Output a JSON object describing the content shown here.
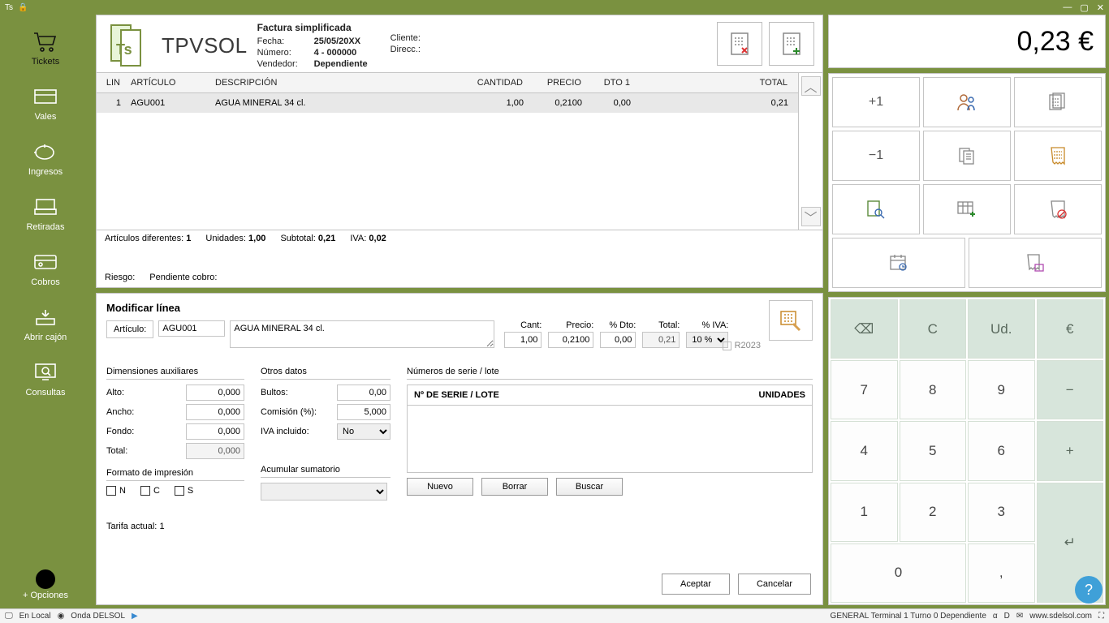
{
  "titlebar": {
    "app": "Ts"
  },
  "sidebar": {
    "items": [
      {
        "label": "Tickets"
      },
      {
        "label": "Vales"
      },
      {
        "label": "Ingresos"
      },
      {
        "label": "Retiradas"
      },
      {
        "label": "Cobros"
      },
      {
        "label": "Abrir cajón"
      },
      {
        "label": "Consultas"
      }
    ],
    "more": "+ Opciones"
  },
  "ticket": {
    "brand": "TPVSOL",
    "header_title": "Factura simplificada",
    "fecha_lbl": "Fecha:",
    "fecha": "25/05/20XX",
    "numero_lbl": "Número:",
    "numero": "4 - 000000",
    "vendedor_lbl": "Vendedor:",
    "vendedor": "Dependiente",
    "cliente_lbl": "Cliente:",
    "direcc_lbl": "Direcc.:",
    "cols": {
      "lin": "LIN",
      "art": "ARTÍCULO",
      "desc": "DESCRIPCIÓN",
      "cant": "CANTIDAD",
      "prec": "PRECIO",
      "dto": "DTO 1",
      "tot": "TOTAL"
    },
    "rows": [
      {
        "lin": "1",
        "art": "AGU001",
        "desc": "AGUA MINERAL 34 cl.",
        "cant": "1,00",
        "prec": "0,2100",
        "dto": "0,00",
        "tot": "0,21"
      }
    ],
    "footer": {
      "art_dif_lbl": "Artículos diferentes:",
      "art_dif": "1",
      "unid_lbl": "Unidades:",
      "unid": "1,00",
      "sub_lbl": "Subtotal:",
      "sub": "0,21",
      "iva_lbl": "IVA:",
      "iva": "0,02",
      "riesgo_lbl": "Riesgo:",
      "pend_lbl": "Pendiente cobro:"
    }
  },
  "edit": {
    "title": "Modificar línea",
    "art_lbl": "Artículo:",
    "art_code": "AGU001",
    "art_desc": "AGUA MINERAL 34 cl.",
    "mini": {
      "cant_lbl": "Cant:",
      "cant": "1,00",
      "prec_lbl": "Precio:",
      "prec": "0,2100",
      "dto_lbl": "% Dto:",
      "dto": "0,00",
      "tot_lbl": "Total:",
      "tot": "0,21",
      "iva_lbl": "% IVA:",
      "iva": "10 %"
    },
    "r2023": "R2023",
    "dim": {
      "title": "Dimensiones auxiliares",
      "alto_lbl": "Alto:",
      "alto": "0,000",
      "ancho_lbl": "Ancho:",
      "ancho": "0,000",
      "fondo_lbl": "Fondo:",
      "fondo": "0,000",
      "total_lbl": "Total:",
      "total": "0,000"
    },
    "otros": {
      "title": "Otros datos",
      "bultos_lbl": "Bultos:",
      "bultos": "0,00",
      "com_lbl": "Comisión (%):",
      "com": "5,000",
      "ivainc_lbl": "IVA incluido:",
      "ivainc": "No"
    },
    "serie": {
      "title": "Números de serie / lote",
      "col1": "Nº DE SERIE / LOTE",
      "col2": "UNIDADES",
      "b_nuevo": "Nuevo",
      "b_borrar": "Borrar",
      "b_buscar": "Buscar"
    },
    "fmt": {
      "title": "Formato de impresión",
      "n": "N",
      "c": "C",
      "s": "S"
    },
    "acum": {
      "title": "Acumular sumatorio"
    },
    "tarifa_lbl": "Tarifa actual:",
    "tarifa": "1",
    "accept": "Aceptar",
    "cancel": "Cancelar"
  },
  "total_display": "0,23 €",
  "actions": {
    "plus1": "+1",
    "minus1": "−1"
  },
  "keypad": {
    "back": "⌫",
    "c": "C",
    "ud": "Ud.",
    "eur": "€",
    "k7": "7",
    "k8": "8",
    "k9": "9",
    "kminus": "−",
    "k4": "4",
    "k5": "5",
    "k6": "6",
    "kplus": "+",
    "k1": "1",
    "k2": "2",
    "k3": "3",
    "kenter": "↵",
    "k0": "0",
    "kcomma": ","
  },
  "status": {
    "local": "En Local",
    "onda": "Onda DELSOL",
    "right": "GENERAL  Terminal 1  Turno 0  Dependiente",
    "url": "www.sdelsol.com"
  }
}
